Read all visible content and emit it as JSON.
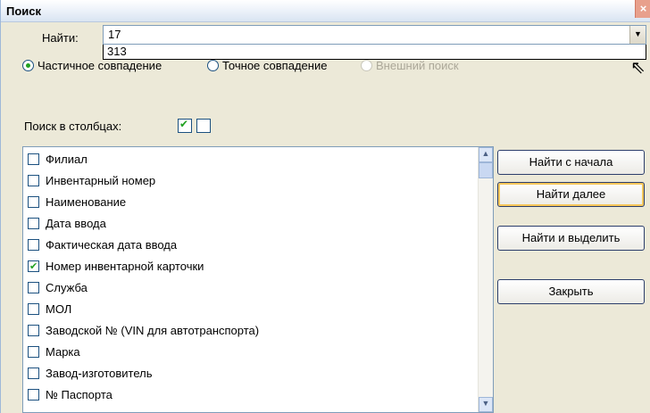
{
  "window": {
    "title": "Поиск",
    "close_glyph": "×"
  },
  "find": {
    "label": "Найти:",
    "value": "17",
    "dropdown_items": [
      "313"
    ]
  },
  "match_modes": [
    {
      "label": "Частичное совпадение",
      "selected": true,
      "enabled": true
    },
    {
      "label": "Точное совпадение",
      "selected": false,
      "enabled": true
    },
    {
      "label": "Внешний поиск",
      "selected": false,
      "enabled": false
    }
  ],
  "columns_search": {
    "label": "Поиск в столбцах:",
    "toggle_all_checked": true,
    "toggle_none_checked": false
  },
  "columns": [
    {
      "label": "Филиал",
      "checked": false
    },
    {
      "label": "Инвентарный номер",
      "checked": false
    },
    {
      "label": "Наименование",
      "checked": false
    },
    {
      "label": "Дата ввода",
      "checked": false
    },
    {
      "label": "Фактическая дата ввода",
      "checked": false
    },
    {
      "label": "Номер инвентарной карточки",
      "checked": true
    },
    {
      "label": "Служба",
      "checked": false
    },
    {
      "label": "МОЛ",
      "checked": false
    },
    {
      "label": "Заводской № (VIN для автотранспорта)",
      "checked": false
    },
    {
      "label": "Марка",
      "checked": false
    },
    {
      "label": "Завод-изготовитель",
      "checked": false
    },
    {
      "label": "№ Паспорта",
      "checked": false
    }
  ],
  "buttons": {
    "find_from_start": "Найти с начала",
    "find_next": "Найти далее",
    "find_and_select": "Найти и выделить",
    "close": "Закрыть"
  },
  "icons": {
    "combo_arrow": "chevron-down-icon",
    "scroll_up": "arrow-up-icon",
    "scroll_down": "arrow-down-icon",
    "cursor": "mouse-pointer-icon"
  }
}
